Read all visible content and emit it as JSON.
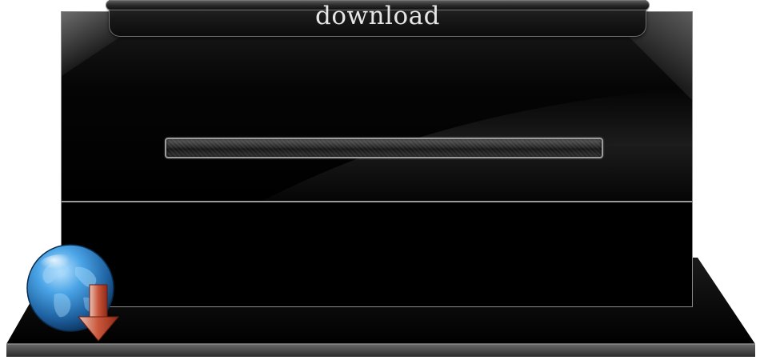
{
  "window": {
    "title": "download"
  },
  "progress": {
    "value": 0
  },
  "icons": {
    "badge": "globe-download-icon"
  },
  "colors": {
    "panel": "#000000",
    "title_text": "#e6e6e6",
    "arrow": "#b5462f",
    "globe": "#2b7fc0"
  }
}
